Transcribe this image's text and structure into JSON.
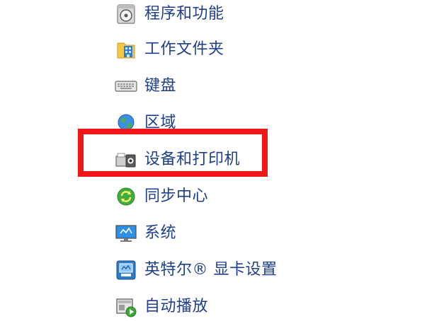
{
  "control_panel": {
    "items": [
      {
        "label": "程序和功能",
        "icon": "programs-features-icon"
      },
      {
        "label": "工作文件夹",
        "icon": "work-folders-icon"
      },
      {
        "label": "键盘",
        "icon": "keyboard-icon"
      },
      {
        "label": "区域",
        "icon": "region-globe-icon"
      },
      {
        "label": "设备和打印机",
        "icon": "devices-printers-icon"
      },
      {
        "label": "同步中心",
        "icon": "sync-center-icon"
      },
      {
        "label": "系统",
        "icon": "system-monitor-icon"
      },
      {
        "label": "英特尔® 显卡设置",
        "icon": "intel-graphics-icon"
      },
      {
        "label": "自动播放",
        "icon": "autoplay-icon"
      }
    ],
    "highlighted_item": "设备和打印机"
  },
  "colors": {
    "link_text": "#1e3f8c",
    "highlight_border": "#f01616"
  }
}
